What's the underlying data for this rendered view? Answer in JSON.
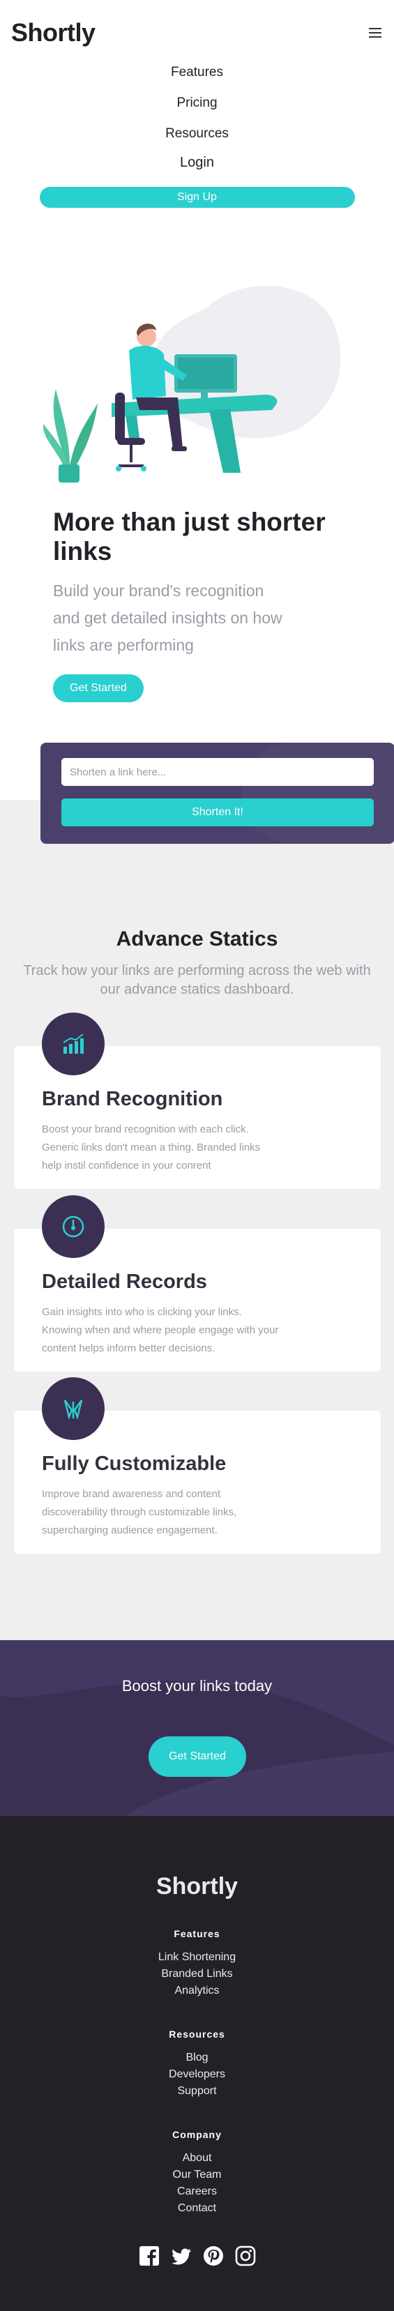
{
  "header": {
    "logo": "Shortly",
    "nav": [
      "Features",
      "Pricing",
      "Resources"
    ],
    "login": "Login",
    "signup": "Sign Up"
  },
  "hero": {
    "title": "More than just shorter links",
    "subtitle": "Build your brand's recognition and get detailed insights on how links are performing",
    "cta": "Get Started"
  },
  "shorten": {
    "placeholder": "Shorten a link here...",
    "button": "Shorten It!"
  },
  "statistics": {
    "title": "Advance Statics",
    "subtitle": "Track how your links are performing across the web with our advance statics dashboard.",
    "cards": [
      {
        "title": "Brand Recognition",
        "text": "Boost your brand recognition with each click. Generic links don't mean a thing. Branded links help instil confidence in your conrent",
        "icon": "chart-icon"
      },
      {
        "title": "Detailed Records",
        "text": "Gain insights into who is clicking your links. Knowing when and where people engage with your content helps inform better decisions.",
        "icon": "gauge-icon"
      },
      {
        "title": "Fully Customizable",
        "text": "Improve brand awareness and content discoverability through customizable links, supercharging audience engagement.",
        "icon": "brush-icon"
      }
    ]
  },
  "boost": {
    "title": "Boost your links today",
    "cta": "Get Started"
  },
  "footer": {
    "logo": "Shortly",
    "columns": [
      {
        "heading": "Features",
        "links": [
          "Link Shortening",
          "Branded Links",
          "Analytics"
        ]
      },
      {
        "heading": "Resources",
        "links": [
          "Blog",
          "Developers",
          "Support"
        ]
      },
      {
        "heading": "Company",
        "links": [
          "About",
          "Our Team",
          "Careers",
          "Contact"
        ]
      }
    ],
    "social": [
      "facebook-icon",
      "twitter-icon",
      "pinterest-icon",
      "instagram-icon"
    ]
  },
  "colors": {
    "cyan": "#2acfcf",
    "dark_violet": "#3b3054",
    "very_dark": "#232127",
    "grey": "#9e9aa7"
  }
}
